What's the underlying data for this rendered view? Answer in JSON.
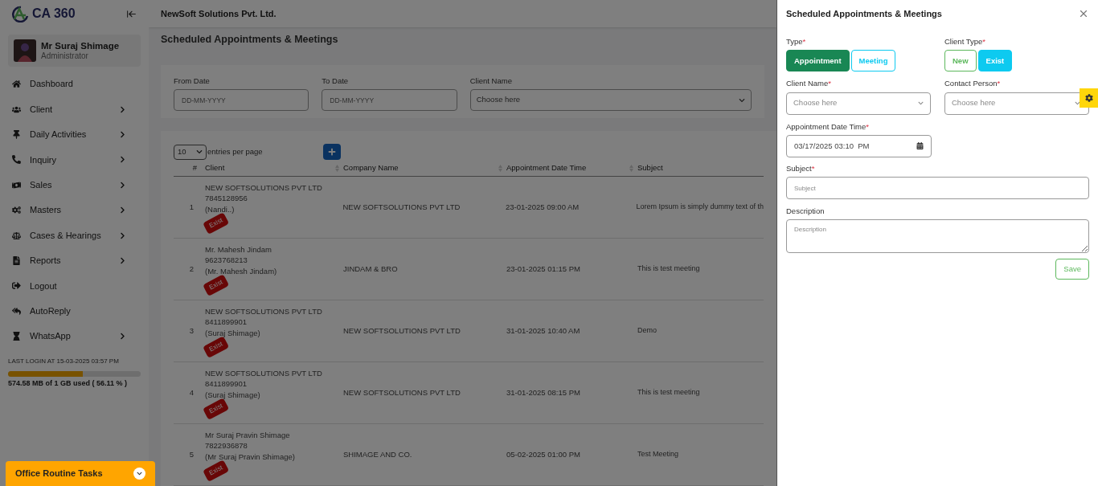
{
  "sidebar": {
    "logo": "CA 360",
    "user": {
      "name": "Mr Suraj Shimage",
      "role": "Administrator"
    },
    "items": [
      {
        "label": "Dashboard",
        "expandable": false
      },
      {
        "label": "Client",
        "expandable": true
      },
      {
        "label": "Daily Activities",
        "expandable": true
      },
      {
        "label": "Inquiry",
        "expandable": true
      },
      {
        "label": "Sales",
        "expandable": true
      },
      {
        "label": "Masters",
        "expandable": true
      },
      {
        "label": "Cases & Hearings",
        "expandable": true
      },
      {
        "label": "Reports",
        "expandable": true
      },
      {
        "label": "Logout",
        "expandable": false
      },
      {
        "label": "AutoReply",
        "expandable": false
      },
      {
        "label": "WhatsApp",
        "expandable": true
      }
    ],
    "last_login": "LAST LOGIN AT 15-03-2025 03:57 PM",
    "storage": {
      "level": 0.5611,
      "reading": "574.58 MB of 1 GB used ( 56.11 % )"
    },
    "tasks_bar": "Office Routine Tasks"
  },
  "header": {
    "company": "NewSoft Solutions Pvt. Ltd."
  },
  "page_title": "Scheduled Appointments & Meetings",
  "filters": [
    {
      "label": "From Date",
      "placeholder": "DD-MM-YYYY",
      "kind": "date"
    },
    {
      "label": "To Date",
      "placeholder": "DD-MM-YYYY",
      "kind": "date"
    },
    {
      "label": "Client Name",
      "placeholder": "Choose here",
      "kind": "select"
    }
  ],
  "table": {
    "page_size": "10",
    "page_size_label": "entries per page",
    "columns": [
      "#",
      "Client",
      "Company Name",
      "Appointment Date Time",
      "Subject"
    ],
    "rows": [
      {
        "index": "1",
        "client": "NEW SOFTSOLUTIONS PVT LTD",
        "phone": "7845128956",
        "contact": "(Nandi..)",
        "tag": "Exist",
        "company": "NEW SOFTSOLUTIONS PVT LTD",
        "datetime": "23-01-2025 09:00 AM",
        "subject": "Lorem Ipsum is simply dummy text of th"
      },
      {
        "index": "2",
        "client": "Mr. Mahesh Jindam",
        "phone": "9623768213",
        "contact": "(Mr. Mahesh Jindam)",
        "tag": "Exist",
        "company": "JINDAM & BRO",
        "datetime": "23-01-2025 01:15 PM",
        "subject": "This is test meeting"
      },
      {
        "index": "3",
        "client": "NEW SOFTSOLUTIONS PVT LTD",
        "phone": "8411899901",
        "contact": "(Suraj Shimage)",
        "tag": "Exist",
        "company": "NEW SOFTSOLUTIONS PVT LTD",
        "datetime": "31-01-2025 10:40 AM",
        "subject": "Demo"
      },
      {
        "index": "4",
        "client": "NEW SOFTSOLUTIONS PVT LTD",
        "phone": "8411899901",
        "contact": "(Suraj Shimage)",
        "tag": "Exist",
        "company": "NEW SOFTSOLUTIONS PVT LTD",
        "datetime": "31-01-2025 08:15 PM",
        "subject": "This is test meeting"
      },
      {
        "index": "5",
        "client": "Mr Suraj Pravin Shimage",
        "phone": "7822936878",
        "contact": "(Mr Suraj Pravin Shimage)",
        "tag": "Exist",
        "company": "SHIMAGE AND CO.",
        "datetime": "05-02-2025 01:00 PM",
        "subject": "Test Meeting"
      }
    ]
  },
  "drawer": {
    "title": "Scheduled Appointments & Meetings",
    "type": {
      "label": "Type",
      "options": [
        {
          "label": "Appointment",
          "selected": true
        },
        {
          "label": "Meeting",
          "selected": false
        }
      ]
    },
    "client_type": {
      "label": "Client Type",
      "options": [
        {
          "label": "New",
          "selected": false
        },
        {
          "label": "Exist",
          "selected": true
        }
      ]
    },
    "client_name": {
      "label": "Client Name",
      "placeholder": "Choose here"
    },
    "contact_person": {
      "label": "Contact Person",
      "placeholder": "Choose here"
    },
    "datetime": {
      "label": "Appointment Date Time",
      "value": "03/17/2025 03:10  PM"
    },
    "subject": {
      "label": "Subject",
      "placeholder": "Subject"
    },
    "description": {
      "label": "Description",
      "placeholder": "Description"
    },
    "required_mark": "*",
    "save": "Save"
  }
}
